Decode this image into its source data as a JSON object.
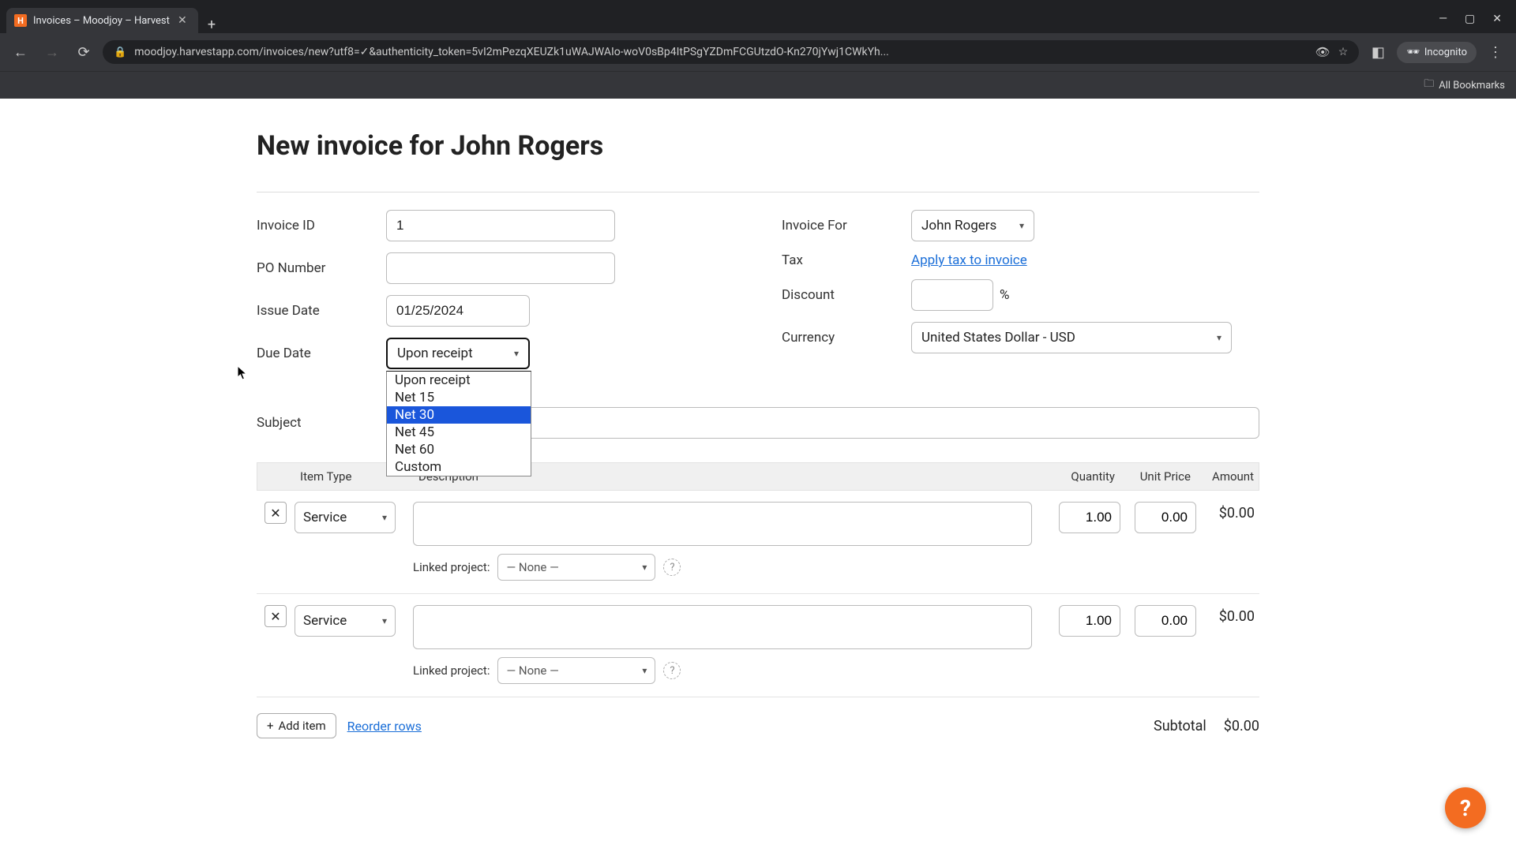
{
  "browser": {
    "tab_title": "Invoices – Moodjoy – Harvest",
    "url": "moodjoy.harvestapp.com/invoices/new?utf8=✓&authenticity_token=5vI2mPezqXEUZk1uWAJWAIo-woV0sBp4ItPSgYZDmFCGUtzdO-Kn270jYwj1CWkYh...",
    "incognito_label": "Incognito",
    "all_bookmarks": "All Bookmarks"
  },
  "page": {
    "title": "New invoice for John Rogers",
    "labels": {
      "invoice_id": "Invoice ID",
      "po_number": "PO Number",
      "issue_date": "Issue Date",
      "due_date": "Due Date",
      "invoice_for": "Invoice For",
      "tax": "Tax",
      "discount": "Discount",
      "currency": "Currency",
      "subject": "Subject"
    },
    "values": {
      "invoice_id": "1",
      "po_number": "",
      "issue_date": "01/25/2024",
      "due_date": "Upon receipt",
      "invoice_for": "John Rogers",
      "tax_link": "Apply tax to invoice",
      "discount": "",
      "discount_unit": "%",
      "currency": "United States Dollar - USD"
    },
    "due_date_options": [
      "Upon receipt",
      "Net 15",
      "Net 30",
      "Net 45",
      "Net 60",
      "Custom"
    ],
    "due_date_highlight_index": 2,
    "table": {
      "headers": {
        "item_type": "Item Type",
        "description": "Description",
        "quantity": "Quantity",
        "unit_price": "Unit Price",
        "amount": "Amount"
      },
      "rows": [
        {
          "type": "Service",
          "description": "",
          "quantity": "1.00",
          "unit_price": "0.00",
          "amount": "$0.00",
          "linked_project_label": "Linked project:",
          "linked_project": "— None —"
        },
        {
          "type": "Service",
          "description": "",
          "quantity": "1.00",
          "unit_price": "0.00",
          "amount": "$0.00",
          "linked_project_label": "Linked project:",
          "linked_project": "— None —"
        }
      ]
    },
    "footer": {
      "add_item": "Add item",
      "reorder": "Reorder rows",
      "subtotal_label": "Subtotal",
      "subtotal_value": "$0.00"
    },
    "help": "?"
  }
}
